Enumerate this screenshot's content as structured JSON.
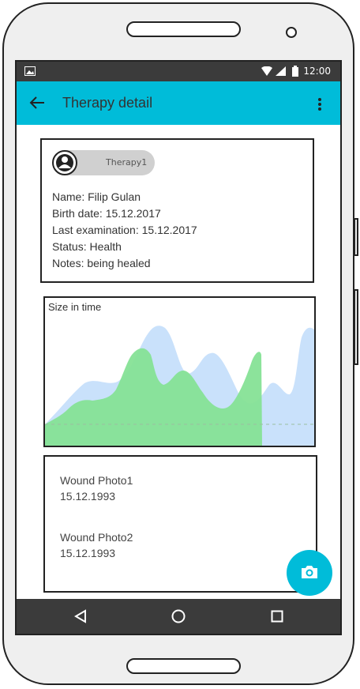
{
  "status_bar": {
    "time": "12:00"
  },
  "app_bar": {
    "title": "Therapy detail"
  },
  "patient": {
    "chip_label": "Therapy1",
    "lines": [
      "Name: Filip Gulan",
      "Birth date: 15.12.2017",
      "Last examination: 15.12.2017",
      "Status: Health",
      "Notes: being healed"
    ]
  },
  "chart": {
    "title": "Size in time",
    "colors": {
      "blue": "#c9e1fb",
      "green": "#86e196"
    }
  },
  "photos": [
    {
      "name": "Wound Photo1",
      "date": "15.12.1993"
    },
    {
      "name": "Wound Photo2",
      "date": "15.12.1993"
    }
  ],
  "fab": {
    "icon": "camera-icon"
  },
  "navbar": {
    "icons": [
      "back-icon",
      "home-icon",
      "recents-icon"
    ]
  },
  "colors": {
    "accent": "#00bcd9",
    "bars": "#3b3b3b"
  }
}
